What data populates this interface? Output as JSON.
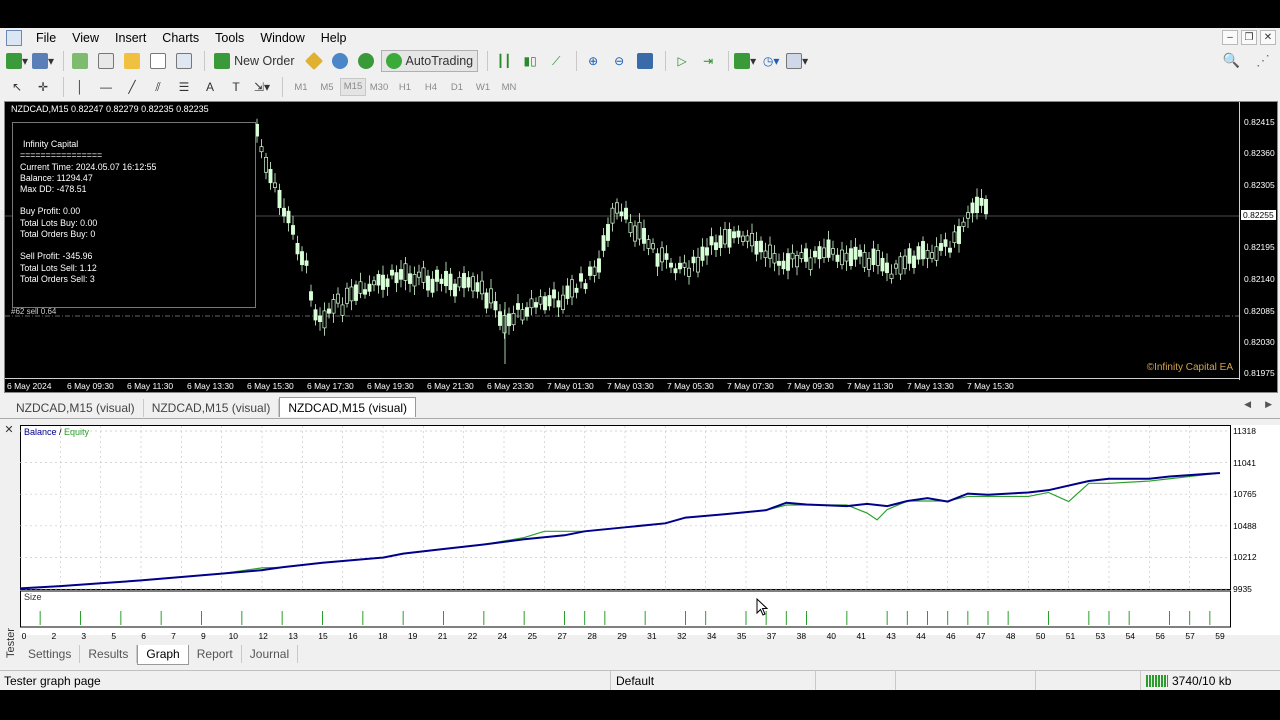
{
  "menu": [
    "File",
    "View",
    "Insert",
    "Charts",
    "Tools",
    "Window",
    "Help"
  ],
  "toolbar": {
    "new_order": "New Order",
    "autotrading": "AutoTrading",
    "timeframes": [
      "M1",
      "M5",
      "M15",
      "M30",
      "H1",
      "H4",
      "D1",
      "W1",
      "MN"
    ],
    "selected_timeframe": "M15"
  },
  "chart": {
    "title": "NZDCAD,M15  0.82247 0.82279 0.82235 0.82235",
    "current_price": "0.82255",
    "price_labels": [
      "0.82415",
      "0.82360",
      "0.82305",
      "0.82195",
      "0.82140",
      "0.82085",
      "0.82030",
      "0.81975"
    ],
    "time_labels": [
      "6 May 2024",
      "6 May 09:30",
      "6 May 11:30",
      "6 May 13:30",
      "6 May 15:30",
      "6 May 17:30",
      "6 May 19:30",
      "6 May 21:30",
      "6 May 23:30",
      "7 May 01:30",
      "7 May 03:30",
      "7 May 05:30",
      "7 May 07:30",
      "7 May 09:30",
      "7 May 11:30",
      "7 May 13:30",
      "7 May 15:30"
    ],
    "sell_tag": "#62 sell 0.64",
    "watermark": "©Infinity Capital EA",
    "info": {
      "title": "Infinity Capital",
      "divider": "================",
      "current_time": "Current Time: 2024.05.07 16:12:55",
      "balance": "Balance: 11294.47",
      "max_dd": "Max DD: -478.51",
      "buy_profit": "Buy Profit: 0.00",
      "lots_buy": "Total Lots Buy: 0.00",
      "orders_buy": "Total Orders Buy: 0",
      "sell_profit": "Sell Profit: -345.96",
      "lots_sell": "Total Lots Sell: 1.12",
      "orders_sell": "Total Orders Sell: 3"
    }
  },
  "chart_tabs": [
    "NZDCAD,M15 (visual)",
    "NZDCAD,M15 (visual)",
    "NZDCAD,M15 (visual)"
  ],
  "tester": {
    "side_label": "Tester",
    "tabs": [
      "Settings",
      "Results",
      "Graph",
      "Report",
      "Journal"
    ],
    "active_tab": "Graph",
    "legend_balance": "Balance",
    "legend_sep": " / ",
    "legend_equity": "Equity",
    "size_label": "Size"
  },
  "chart_data": {
    "type": "line",
    "title": "",
    "xlabel": "",
    "ylabel": "",
    "x_ticks": [
      "0",
      "2",
      "3",
      "5",
      "6",
      "7",
      "9",
      "10",
      "12",
      "13",
      "15",
      "16",
      "18",
      "19",
      "21",
      "22",
      "24",
      "25",
      "27",
      "28",
      "29",
      "31",
      "32",
      "34",
      "35",
      "37",
      "38",
      "40",
      "41",
      "43",
      "44",
      "46",
      "47",
      "48",
      "50",
      "51",
      "53",
      "54",
      "56",
      "57",
      "59"
    ],
    "y_ticks": [
      "11318",
      "11041",
      "10765",
      "10488",
      "10212",
      "9935"
    ],
    "ylim": [
      9935,
      11318
    ],
    "xlim": [
      0,
      60
    ],
    "series": [
      {
        "name": "Balance",
        "color": "#00008b",
        "x": [
          0,
          2,
          4,
          6,
          8,
          10,
          12,
          13,
          15,
          18,
          19,
          21,
          23,
          25,
          27,
          28,
          30,
          32,
          33,
          35,
          37,
          38,
          39,
          41,
          42,
          43,
          44,
          45,
          46,
          47,
          48,
          50,
          51,
          53,
          54,
          56,
          57,
          59.5
        ],
        "values": [
          9940,
          9960,
          9985,
          10010,
          10040,
          10070,
          10100,
          10125,
          10165,
          10210,
          10245,
          10285,
          10325,
          10370,
          10405,
          10440,
          10475,
          10510,
          10560,
          10590,
          10625,
          10690,
          10675,
          10660,
          10680,
          10660,
          10705,
          10730,
          10700,
          10770,
          10760,
          10780,
          10800,
          10880,
          10900,
          10900,
          10920,
          10950
        ]
      },
      {
        "name": "Equity",
        "color": "#2aa02a",
        "x": [
          0,
          2,
          4,
          6,
          8,
          10,
          12,
          13,
          15,
          18,
          19,
          21,
          23,
          25,
          26,
          27,
          28,
          30,
          32,
          33,
          35,
          37,
          38,
          39,
          41,
          42,
          42.5,
          43,
          44,
          45,
          46,
          47,
          48,
          50,
          51,
          52,
          53,
          54,
          56,
          57,
          59.5
        ],
        "values": [
          9940,
          9960,
          9985,
          10010,
          10040,
          10070,
          10120,
          10125,
          10165,
          10210,
          10245,
          10285,
          10325,
          10385,
          10440,
          10440,
          10440,
          10475,
          10510,
          10560,
          10590,
          10625,
          10670,
          10670,
          10670,
          10600,
          10540,
          10630,
          10705,
          10705,
          10705,
          10745,
          10745,
          10745,
          10780,
          10700,
          10860,
          10860,
          10880,
          10900,
          10950
        ]
      }
    ],
    "size_bars_x": [
      1,
      3,
      5,
      7,
      9,
      11,
      13,
      15,
      17,
      19,
      21,
      23,
      25,
      27,
      28,
      29,
      31,
      33,
      34,
      36,
      37,
      38,
      39,
      41,
      43,
      44,
      45,
      46,
      47,
      48,
      49,
      51,
      53,
      54,
      55,
      57,
      58,
      59
    ]
  },
  "status": {
    "left": "Tester graph page",
    "profile": "Default",
    "connection": "3740/10 kb"
  }
}
